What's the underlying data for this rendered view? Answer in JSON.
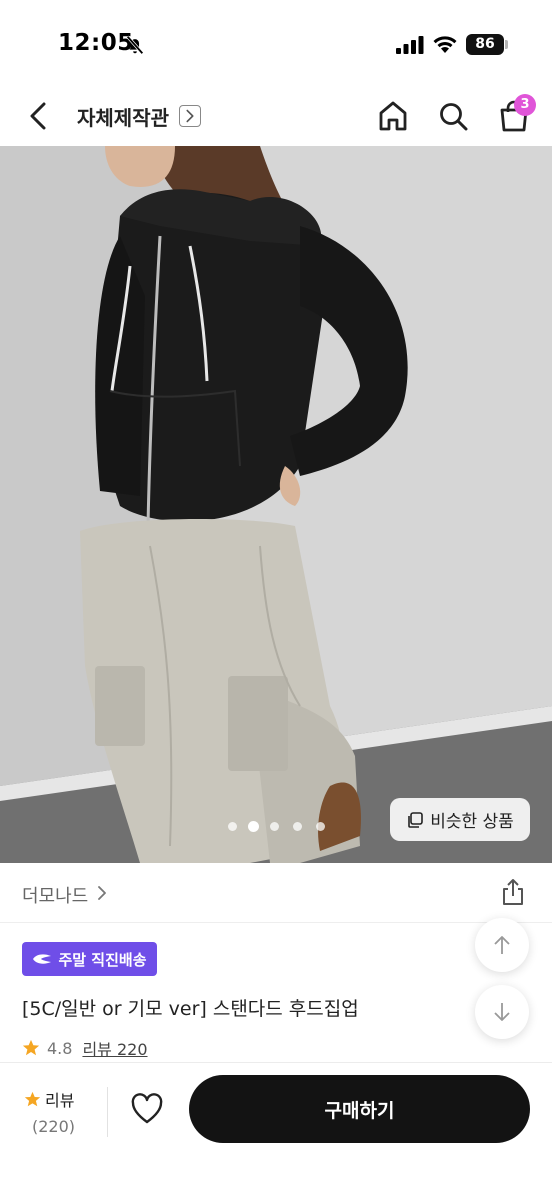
{
  "status_bar": {
    "time": "12:05",
    "battery": "86"
  },
  "header": {
    "shop_name": "자체제작관",
    "cart_count": "3"
  },
  "hero": {
    "similar_button_label": "비슷한 상품",
    "carousel_total": 5,
    "carousel_active_index": 2
  },
  "product": {
    "brand": "더모나드",
    "delivery_badge": "주말 직진배송",
    "title": "[5C/일반 or 기모 ver] 스탠다드 후드집업",
    "rating": "4.8",
    "review_link": "리뷰 220"
  },
  "bottom_bar": {
    "review_label": "리뷰",
    "review_count": "(220)",
    "buy_label": "구매하기"
  },
  "colors": {
    "accent_badge": "#6f4ee8",
    "cart_badge": "#e055d8",
    "star": "#f5a623",
    "buy_button": "#131313"
  },
  "icons": [
    "bell-off-icon",
    "signal-icon",
    "wifi-icon",
    "battery-icon",
    "back-arrow-icon",
    "chevron-right-icon",
    "home-icon",
    "search-icon",
    "cart-icon",
    "copy-icon",
    "share-icon",
    "delivery-icon",
    "star-icon",
    "arrow-up-icon",
    "arrow-down-icon",
    "heart-icon"
  ]
}
